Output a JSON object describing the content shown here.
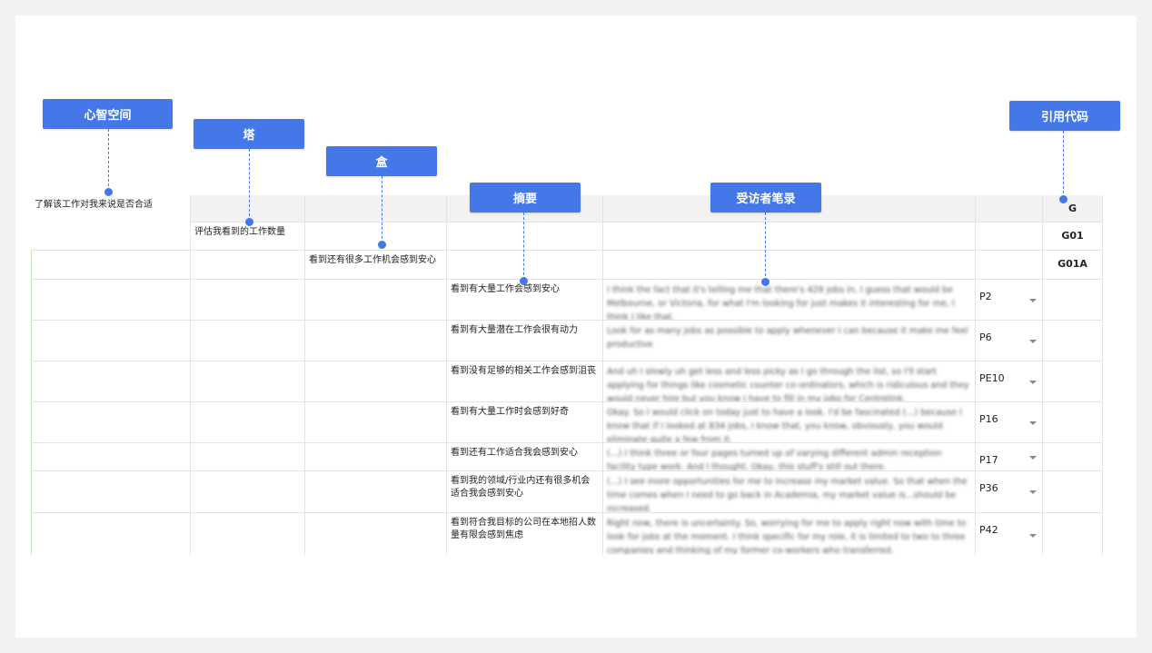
{
  "callouts": {
    "mind_space": "心智空间",
    "tower": "塔",
    "box": "盒",
    "summary": "摘要",
    "interviewee_notes": "受访者笔录",
    "reference_code": "引用代码"
  },
  "sheet": {
    "level1": "了解该工作对我来说是否合适",
    "level2": "评估我看到的工作数量",
    "level3": "看到还有很多工作机会感到安心",
    "codes": {
      "header": "G",
      "l2": "G01",
      "l3": "G01A"
    },
    "rows": [
      {
        "summary": "看到有大量工作会感到安心",
        "note": "I think the fact that it's telling me that there's 429 jobs in, I guess that would be Melbourne, or Victoria, for what I'm looking for just makes it interesting for me, I think I like that.",
        "participant": "P2"
      },
      {
        "summary": "看到有大量潜在工作会很有动力",
        "note": "Look for as many jobs as possible to apply whenever I can because it make me feel productive",
        "participant": "P6"
      },
      {
        "summary": "看到没有足够的相关工作会感到沮丧",
        "note": "And uh I slowly uh get less and less picky as I go through the list, so I'll start applying for things like cosmetic counter co-ordinators, which is ridiculous and they would never hire but you know I have to fill in my jobs for Centrelink.",
        "participant": "PE10"
      },
      {
        "summary": "看到有大量工作时会感到好奇",
        "note": "Okay. So I would click on today just to have a look. I'd be fascinated (...) because I know that if I looked at 834 jobs, I know that, you know, obviously, you would eliminate quite a few from it.",
        "participant": "P16"
      },
      {
        "summary": "看到还有工作适合我会感到安心",
        "note": "(...) I think three or four pages turned up of varying different admin reception facility type work. And I thought, Okay, this stuff's still out there.",
        "participant": "P17"
      },
      {
        "summary": "看到我的领域/行业内还有很多机会适合我会感到安心",
        "note": "(...) I see more opportunities for me to increase my market value. So that when the time comes when I need to go back in Academia, my market value is...should be increased.",
        "participant": "P36"
      },
      {
        "summary": "看到符合我目标的公司在本地招人数量有限会感到焦虑",
        "note": "Right now, there is uncertainty. So, worrying for me to apply right now with time to look for jobs at the moment. I think specific for my role, it is limited to two to three companies and thinking of my former co-workers who transferred.",
        "participant": "P42"
      }
    ]
  }
}
